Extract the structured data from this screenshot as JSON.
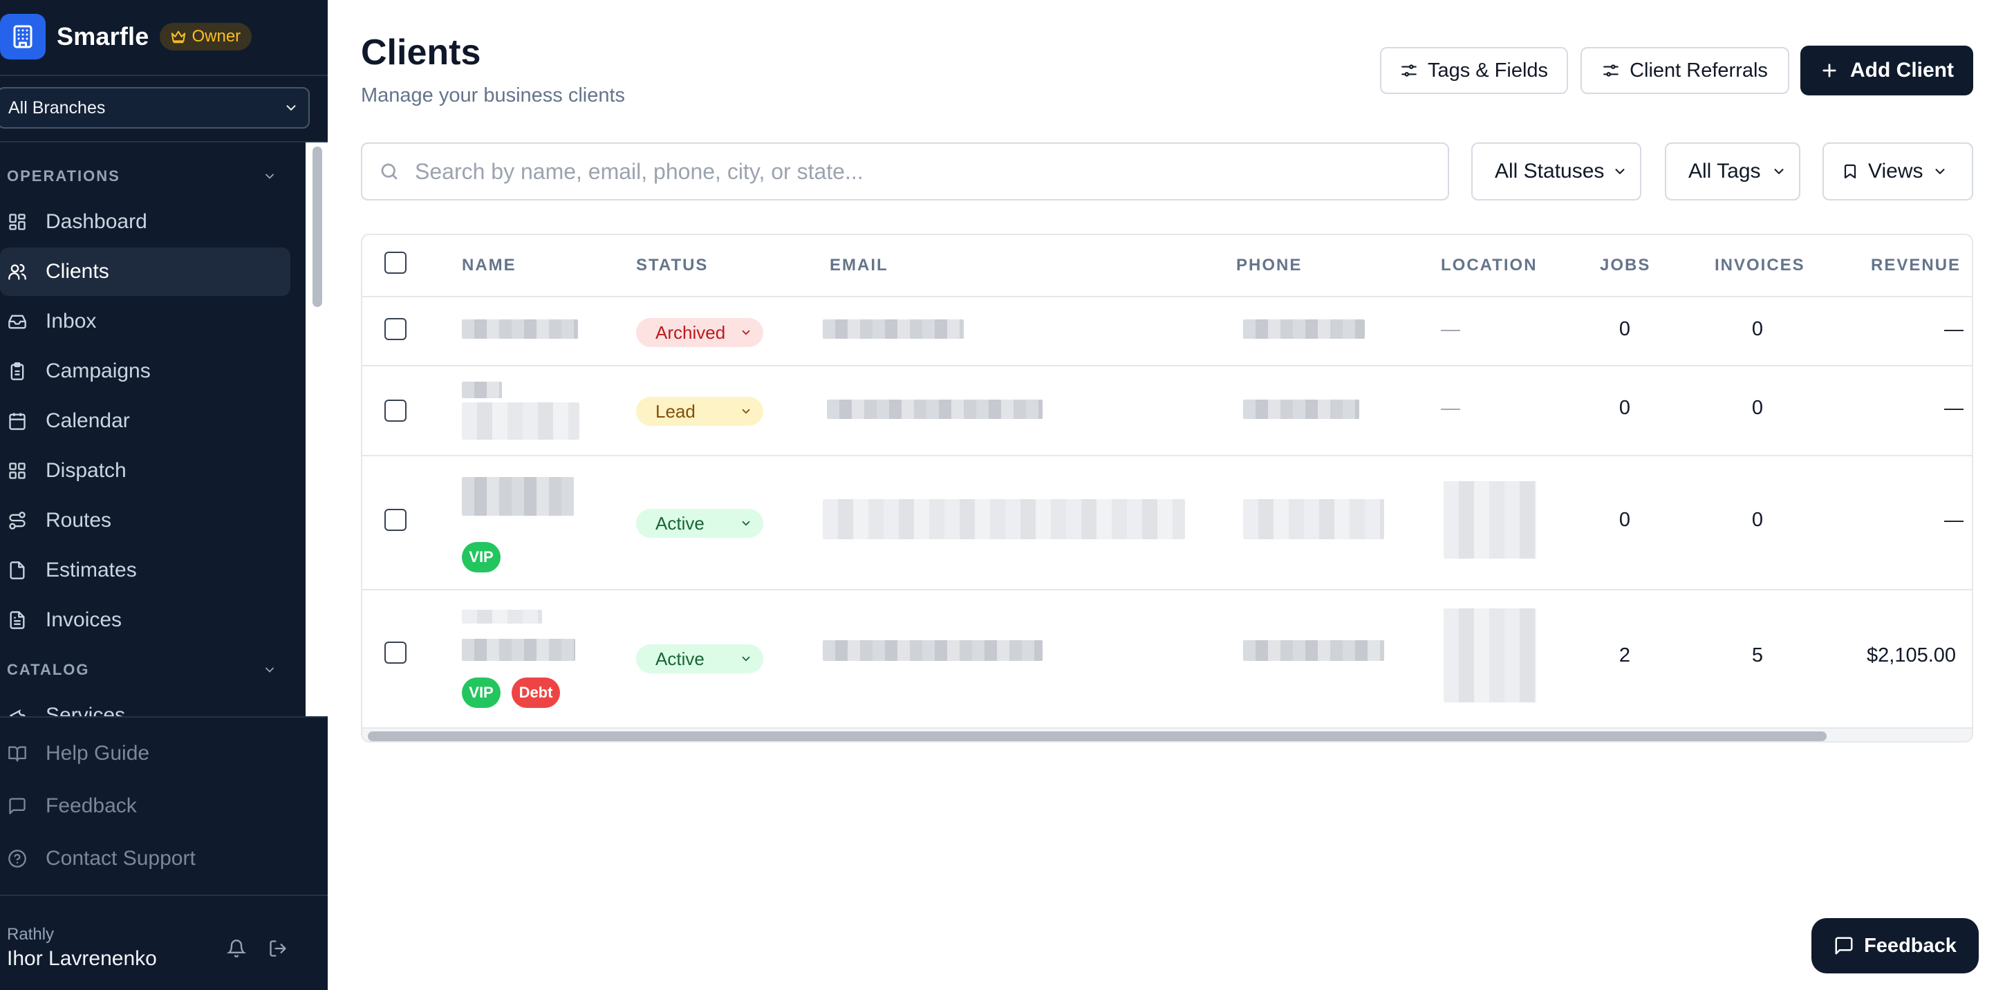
{
  "brand": {
    "name": "Smarfle",
    "badge": "Owner"
  },
  "branch_selector": {
    "value": "All Branches"
  },
  "sidebar": {
    "sections": [
      {
        "label": "OPERATIONS"
      },
      {
        "label": "CATALOG"
      }
    ],
    "items": [
      {
        "label": "Dashboard",
        "icon": "dashboard-icon"
      },
      {
        "label": "Clients",
        "icon": "users-icon",
        "active": true
      },
      {
        "label": "Inbox",
        "icon": "inbox-icon"
      },
      {
        "label": "Campaigns",
        "icon": "clipboard-icon"
      },
      {
        "label": "Calendar",
        "icon": "calendar-icon"
      },
      {
        "label": "Dispatch",
        "icon": "dispatch-icon"
      },
      {
        "label": "Routes",
        "icon": "routes-icon"
      },
      {
        "label": "Estimates",
        "icon": "file-icon"
      },
      {
        "label": "Invoices",
        "icon": "invoice-icon"
      },
      {
        "label": "Services",
        "icon": "wrench-icon"
      }
    ],
    "footer_links": [
      {
        "label": "Help Guide",
        "icon": "book-icon"
      },
      {
        "label": "Feedback",
        "icon": "message-icon"
      },
      {
        "label": "Contact Support",
        "icon": "help-circle-icon"
      }
    ],
    "user": {
      "org": "Rathly",
      "name": "Ihor Lavrenenko"
    }
  },
  "header": {
    "title": "Clients",
    "subtitle": "Manage your business clients",
    "buttons": {
      "tags_fields": "Tags & Fields",
      "referrals": "Client Referrals",
      "add_client": "Add Client"
    }
  },
  "filters": {
    "search_placeholder": "Search by name, email, phone, city, or state...",
    "status": "All Statuses",
    "tags": "All Tags",
    "views": "Views"
  },
  "table": {
    "columns": [
      "NAME",
      "STATUS",
      "EMAIL",
      "PHONE",
      "LOCATION",
      "JOBS",
      "INVOICES",
      "REVENUE"
    ],
    "rows": [
      {
        "status": "Archived",
        "location": "—",
        "jobs": "0",
        "invoices": "0",
        "revenue": "—",
        "tags": []
      },
      {
        "status": "Lead",
        "location": "—",
        "jobs": "0",
        "invoices": "0",
        "revenue": "—",
        "tags": []
      },
      {
        "status": "Active",
        "location": "",
        "jobs": "0",
        "invoices": "0",
        "revenue": "—",
        "tags": [
          "VIP"
        ]
      },
      {
        "status": "Active",
        "location": "",
        "jobs": "2",
        "invoices": "5",
        "revenue": "$2,105.00",
        "tags": [
          "VIP",
          "Debt"
        ]
      }
    ]
  },
  "feedback_fab": {
    "label": "Feedback"
  },
  "colors": {
    "sidebar_bg": "#0f1b2d",
    "brand_blue": "#2563eb",
    "vip_green": "#22c55e",
    "debt_red": "#ef4444"
  }
}
